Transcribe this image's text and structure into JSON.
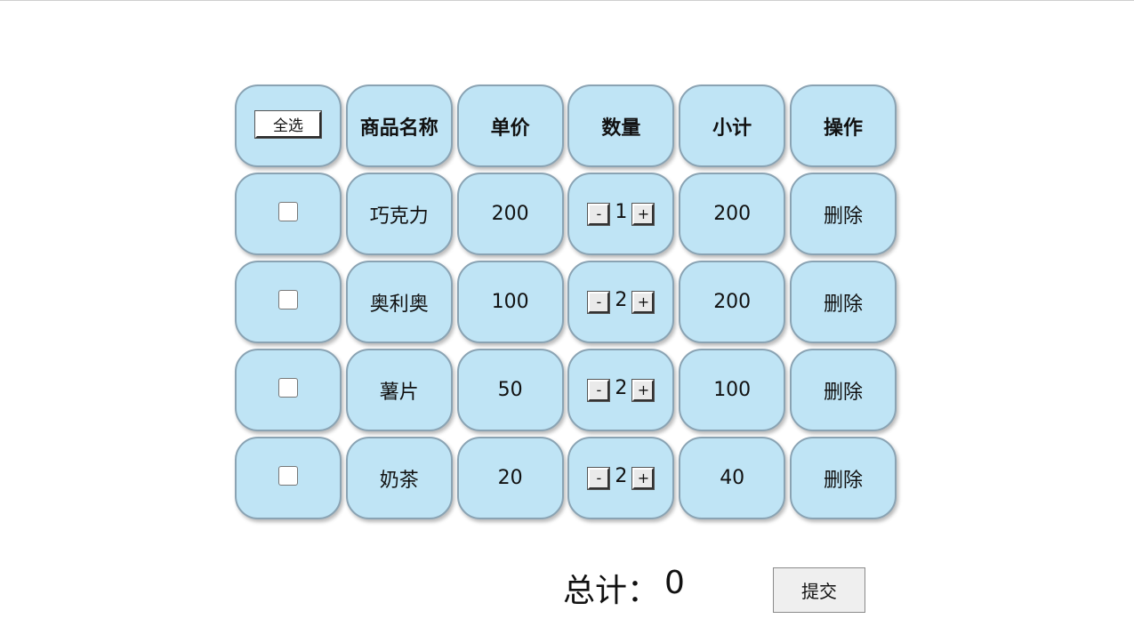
{
  "header": {
    "select_all": "全选",
    "name": "商品名称",
    "price": "单价",
    "quantity": "数量",
    "subtotal": "小计",
    "action": "操作"
  },
  "controls": {
    "minus": "-",
    "plus": "+"
  },
  "items": [
    {
      "name": "巧克力",
      "price": "200",
      "qty": "1",
      "subtotal": "200",
      "action": "删除",
      "checked": false
    },
    {
      "name": "奥利奥",
      "price": "100",
      "qty": "2",
      "subtotal": "200",
      "action": "删除",
      "checked": false
    },
    {
      "name": "薯片",
      "price": "50",
      "qty": "2",
      "subtotal": "100",
      "action": "删除",
      "checked": false
    },
    {
      "name": "奶茶",
      "price": "20",
      "qty": "2",
      "subtotal": "40",
      "action": "删除",
      "checked": false
    }
  ],
  "footer": {
    "total_label": "总计：",
    "total_value": "0",
    "submit": "提交"
  },
  "colors": {
    "cell_bg": "#bfe4f5",
    "cell_border": "#8aa3b3"
  }
}
